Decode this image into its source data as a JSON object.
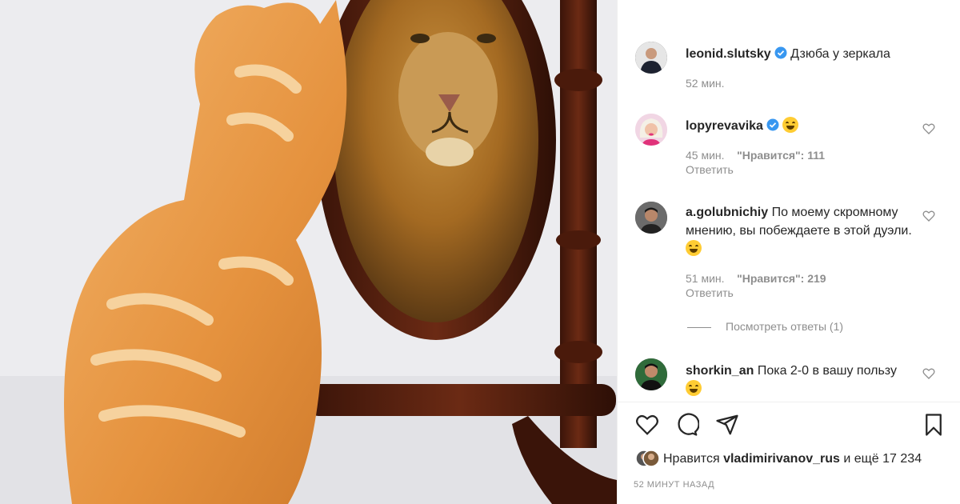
{
  "post": {
    "author": "leonid.slutsky",
    "caption": "Дзюба у зеркала",
    "time": "52 мин."
  },
  "comments": [
    {
      "user": "lopyrevavika",
      "text": "",
      "time": "45 мин.",
      "likes": "\"Нравится\": 111",
      "reply": "Ответить"
    },
    {
      "user": "a.golubnichiy",
      "text": "По моему скромному мнению, вы побеждаете в этой дуэли.",
      "time": "51 мин.",
      "likes": "\"Нравится\": 219",
      "reply": "Ответить"
    },
    {
      "user": "shorkin_an",
      "text": "Пока 2-0 в вашу пользу"
    }
  ],
  "view_replies": "Посмотреть ответы (1)",
  "likes_line": {
    "prefix": "Нравится",
    "user": "vladimirivanov_rus",
    "suffix": "и ещё 17 234"
  },
  "time_ago": "52 МИНУТ НАЗАД",
  "icons": [
    "heart-icon",
    "comment-icon",
    "share-icon",
    "bookmark-icon",
    "verified-badge-icon",
    "laughing-emoji-icon"
  ],
  "colors": {
    "verified": "#3897f0",
    "muted": "#8e8e8e",
    "text": "#262626"
  }
}
